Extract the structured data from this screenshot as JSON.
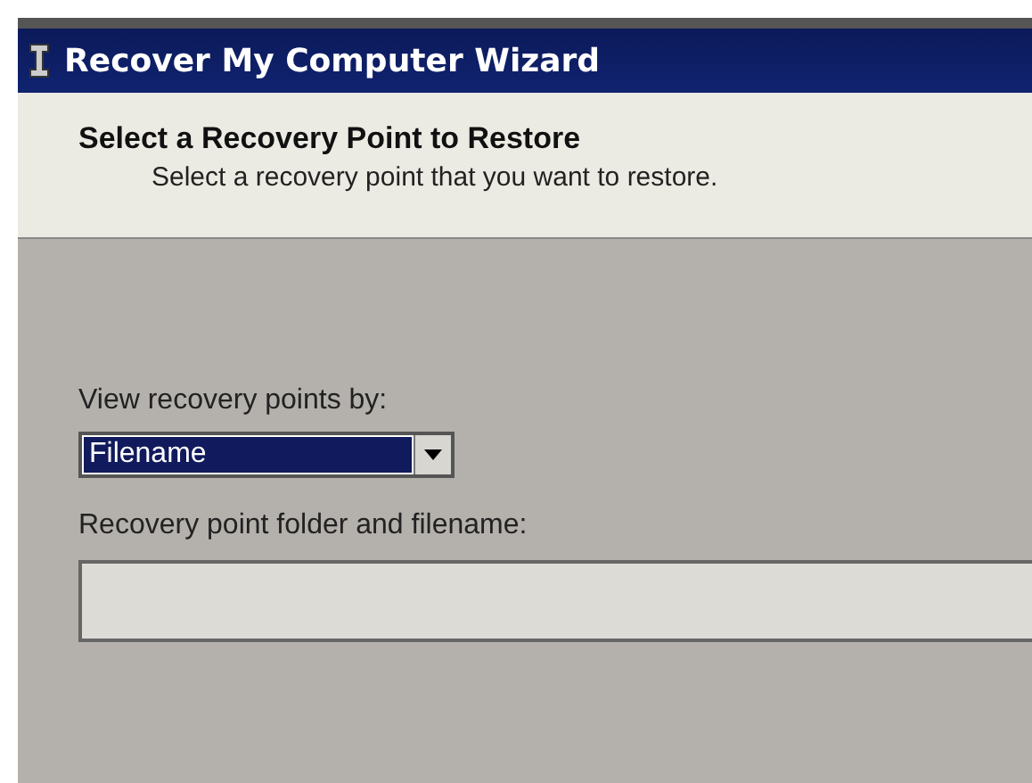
{
  "window": {
    "title": "Recover My Computer Wizard"
  },
  "header": {
    "title": "Select a Recovery Point to Restore",
    "subtitle": "Select a recovery point that you want to restore."
  },
  "view_by": {
    "label": "View recovery points by:",
    "value": "Filename",
    "selected": true
  },
  "folder": {
    "label": "Recovery point folder and filename:"
  }
}
